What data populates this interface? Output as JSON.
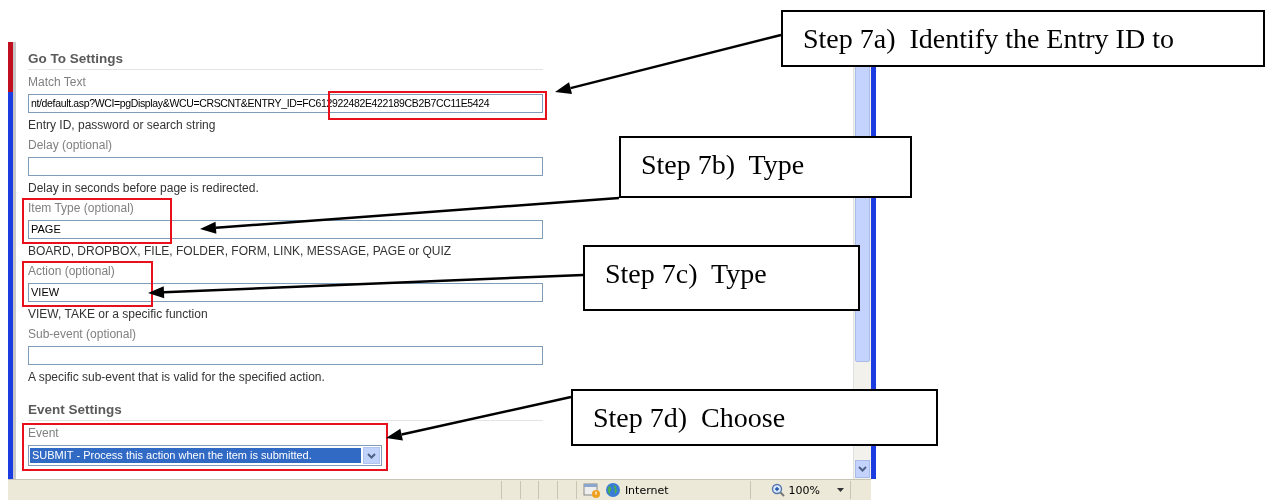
{
  "sections": [
    {
      "title": "Go To Settings",
      "fields": [
        {
          "label": "Match Text",
          "kind": "url",
          "value": "nt/default.asp?WCI=pgDisplay&WCU=CRSCNT&ENTRY_ID=FC612922482E422189CB2B7CC11E5424",
          "hint": "Entry ID, password or search string",
          "highlighted": true
        },
        {
          "label": "Delay (optional)",
          "kind": "text",
          "hint": "Delay in seconds before page is redirected."
        },
        {
          "label": "Item Type (optional)",
          "kind": "text",
          "value": "PAGE",
          "hint": "BOARD, DROPBOX, FILE, FOLDER, FORM, LINK, MESSAGE, PAGE or QUIZ",
          "highlighted": true
        },
        {
          "label": "Action (optional)",
          "kind": "text",
          "value": "VIEW",
          "hint": "VIEW, TAKE or a specific function",
          "highlighted": true
        },
        {
          "label": "Sub-event (optional)",
          "kind": "text",
          "hint": "A specific sub-event that is valid for the specified action."
        }
      ]
    },
    {
      "title": "Event Settings",
      "fields": [
        {
          "label": "Event",
          "kind": "select",
          "value": "SUBMIT - Process this action when the item is submitted.",
          "highlighted": true
        }
      ]
    }
  ],
  "status_bar": {
    "zone": "Internet",
    "zoom": "100%"
  },
  "annotations": [
    {
      "text": "Step 7a)  Identify the Entry ID to"
    },
    {
      "text": "Step 7b)  Type"
    },
    {
      "text": "Step 7c)  Type"
    },
    {
      "text": "Step 7d)  Choose"
    }
  ]
}
